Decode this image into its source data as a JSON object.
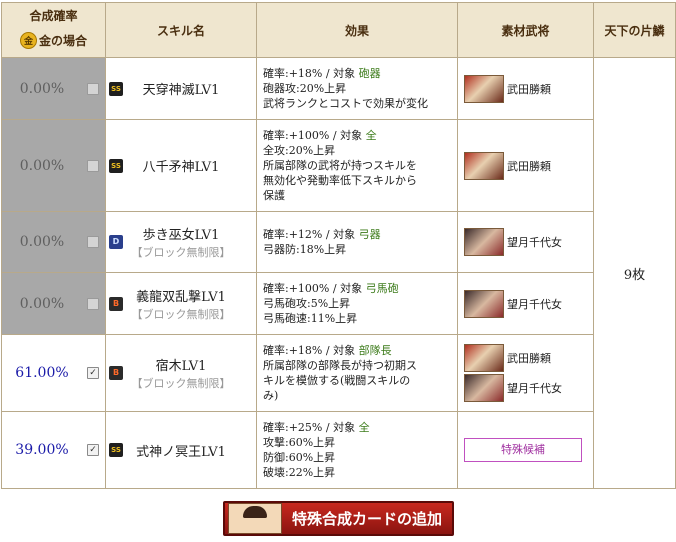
{
  "headers": {
    "rate_line1": "合成確率",
    "gold_icon": "金",
    "rate_line2": "金の場合",
    "skill": "スキル名",
    "effect": "効果",
    "material": "素材武将",
    "cost": "天下の片鱗"
  },
  "rows": [
    {
      "rate": "0.00%",
      "checked": false,
      "rank": "SS",
      "skill": "天穿神滅LV1",
      "block": "",
      "effect": [
        {
          "t": "確率:+18%  /  対象 ",
          "h": "砲器"
        },
        {
          "t": "砲器攻:20%上昇",
          "h": ""
        },
        {
          "t": "武将ランクとコストで効果が変化",
          "h": ""
        }
      ],
      "materials": [
        "武田勝頼"
      ]
    },
    {
      "rate": "0.00%",
      "checked": false,
      "rank": "SS",
      "skill": "八千矛神LV1",
      "block": "",
      "effect": [
        {
          "t": "確率:+100%  /  対象 ",
          "h": "全"
        },
        {
          "t": "全攻:20%上昇",
          "h": ""
        },
        {
          "t": "所属部隊の武将が持つスキルを",
          "h": ""
        },
        {
          "t": "無効化や発動率低下スキルから",
          "h": ""
        },
        {
          "t": "保護",
          "h": ""
        }
      ],
      "materials": [
        "武田勝頼"
      ]
    },
    {
      "rate": "0.00%",
      "checked": false,
      "rank": "D",
      "skill": "歩き巫女LV1",
      "block": "【ブロック無制限】",
      "effect": [
        {
          "t": "確率:+12%  /  対象 ",
          "h": "弓器"
        },
        {
          "t": "弓器防:18%上昇",
          "h": ""
        }
      ],
      "materials": [
        "望月千代女"
      ]
    },
    {
      "rate": "0.00%",
      "checked": false,
      "rank": "B",
      "skill": "義龍双乱撃LV1",
      "block": "【ブロック無制限】",
      "effect": [
        {
          "t": "確率:+100%  /  対象 ",
          "h": "弓馬砲"
        },
        {
          "t": "弓馬砲攻:5%上昇",
          "h": ""
        },
        {
          "t": "弓馬砲速:11%上昇",
          "h": ""
        }
      ],
      "materials": [
        "望月千代女"
      ]
    },
    {
      "rate": "61.00%",
      "checked": true,
      "rank": "B",
      "skill": "宿木LV1",
      "block": "【ブロック無制限】",
      "effect": [
        {
          "t": "確率:+18%  /  対象 ",
          "h": "部隊長"
        },
        {
          "t": "所属部隊の部隊長が持つ初期ス",
          "h": ""
        },
        {
          "t": "キルを模倣する(戦闘スキルの",
          "h": ""
        },
        {
          "t": "み)",
          "h": ""
        }
      ],
      "materials": [
        "武田勝頼",
        "望月千代女"
      ]
    },
    {
      "rate": "39.00%",
      "checked": true,
      "rank": "SS",
      "skill": "式神ノ冥王LV1",
      "block": "",
      "effect": [
        {
          "t": "確率:+25%  /  対象 ",
          "h": "全"
        },
        {
          "t": "攻撃:60%上昇",
          "h": ""
        },
        {
          "t": "防御:60%上昇",
          "h": ""
        },
        {
          "t": "破壊:22%上昇",
          "h": ""
        }
      ],
      "materials": []
    }
  ],
  "special_candidate": "特殊候補",
  "cost_value": "9枚",
  "check_mark": "✓",
  "add_button_label": "特殊合成カードの追加",
  "colors": {
    "gray_cell": "#a8a8a8",
    "rate_blue": "#1a1aa8",
    "target_green": "#3c7b1a",
    "header_bg": "#efe6cf",
    "button_red": "#c8281e"
  }
}
